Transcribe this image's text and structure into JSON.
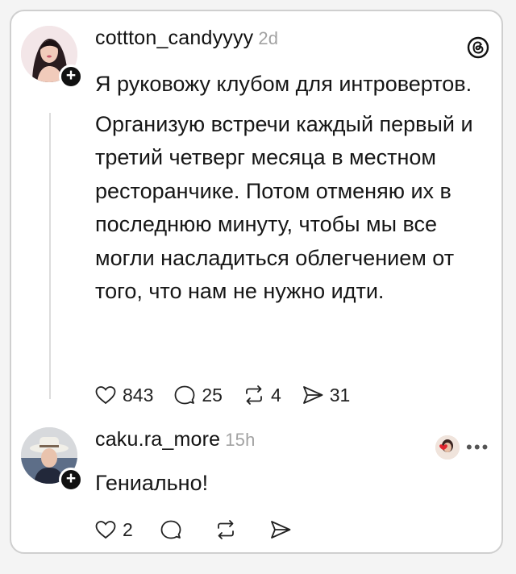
{
  "post": {
    "username": "cottton_candyyyy",
    "time": "2d",
    "avatar_icon": "user-avatar-woman-icon",
    "text": [
      "Я руковожу клубом для интровертов.",
      "Организую встречи каждый первый и третий четверг месяца в местном ресторанчике. Потом отменяю их в последнюю минуту, чтобы мы все могли насладиться облегчением от того, что нам не нужно идти."
    ],
    "likes": "843",
    "comments": "25",
    "reposts": "4",
    "shares": "31"
  },
  "reply": {
    "username": "caku.ra_more",
    "time": "15h",
    "avatar_icon": "user-avatar-woman-hat-icon",
    "text": "Гениально!",
    "likes": "2"
  },
  "colors": {
    "text": "#161616",
    "muted": "#a2a2a2",
    "border": "#cfcfcf",
    "background": "#ffffff"
  }
}
